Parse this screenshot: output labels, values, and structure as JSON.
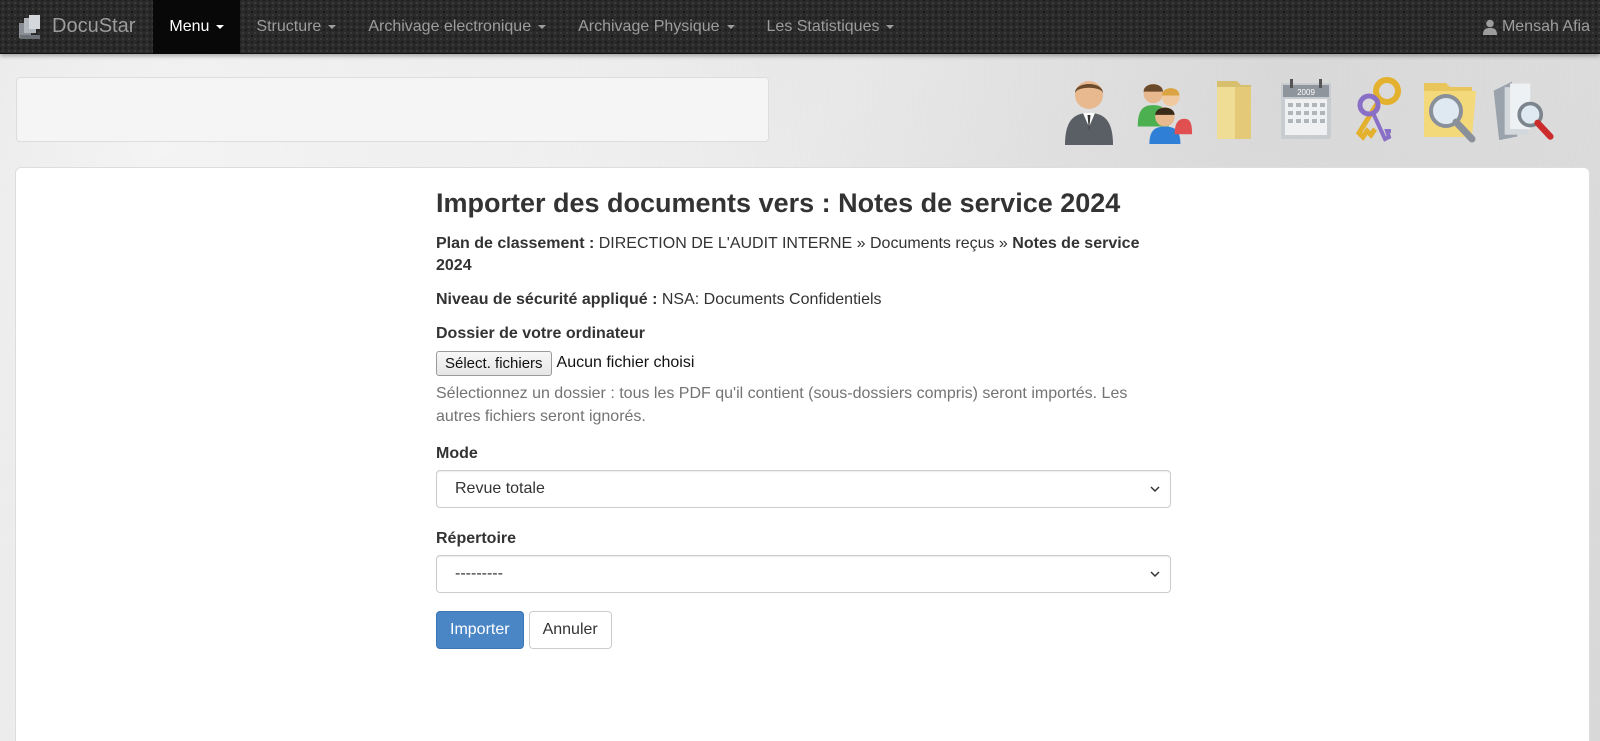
{
  "navbar": {
    "brand": "DocuStar",
    "items": [
      {
        "label": "Menu",
        "active": true
      },
      {
        "label": "Structure"
      },
      {
        "label": "Archivage electronique"
      },
      {
        "label": "Archivage Physique"
      },
      {
        "label": "Les Statistiques"
      }
    ],
    "user": "Mensah Afia"
  },
  "toolbar_icons": [
    "user-icon",
    "users-group-icon",
    "folder-icon",
    "calendar-icon",
    "keys-icon",
    "search-folder-icon",
    "search-document-icon"
  ],
  "calendar_year": "2009",
  "page": {
    "title": "Importer des documents vers : Notes de service 2024",
    "plan_label": "Plan de classement :",
    "plan_path": "DIRECTION DE L'AUDIT INTERNE » Documents reçus »",
    "plan_current": "Notes de service 2024",
    "security_label": "Niveau de sécurité appliqué :",
    "security_value": "NSA: Documents Confidentiels",
    "folder_label": "Dossier de votre ordinateur",
    "file_button": "Sélect. fichiers",
    "file_status": "Aucun fichier choisi",
    "help_text": "Sélectionnez un dossier : tous les PDF qu'il contient (sous-dossiers compris) seront importés. Les autres fichiers seront ignorés.",
    "mode_label": "Mode",
    "mode_value": "Revue totale",
    "repertoire_label": "Répertoire",
    "repertoire_value": "---------",
    "import_button": "Importer",
    "cancel_button": "Annuler"
  },
  "colors": {
    "primary": "#4a86c5",
    "navbar": "#2a2a2a"
  }
}
